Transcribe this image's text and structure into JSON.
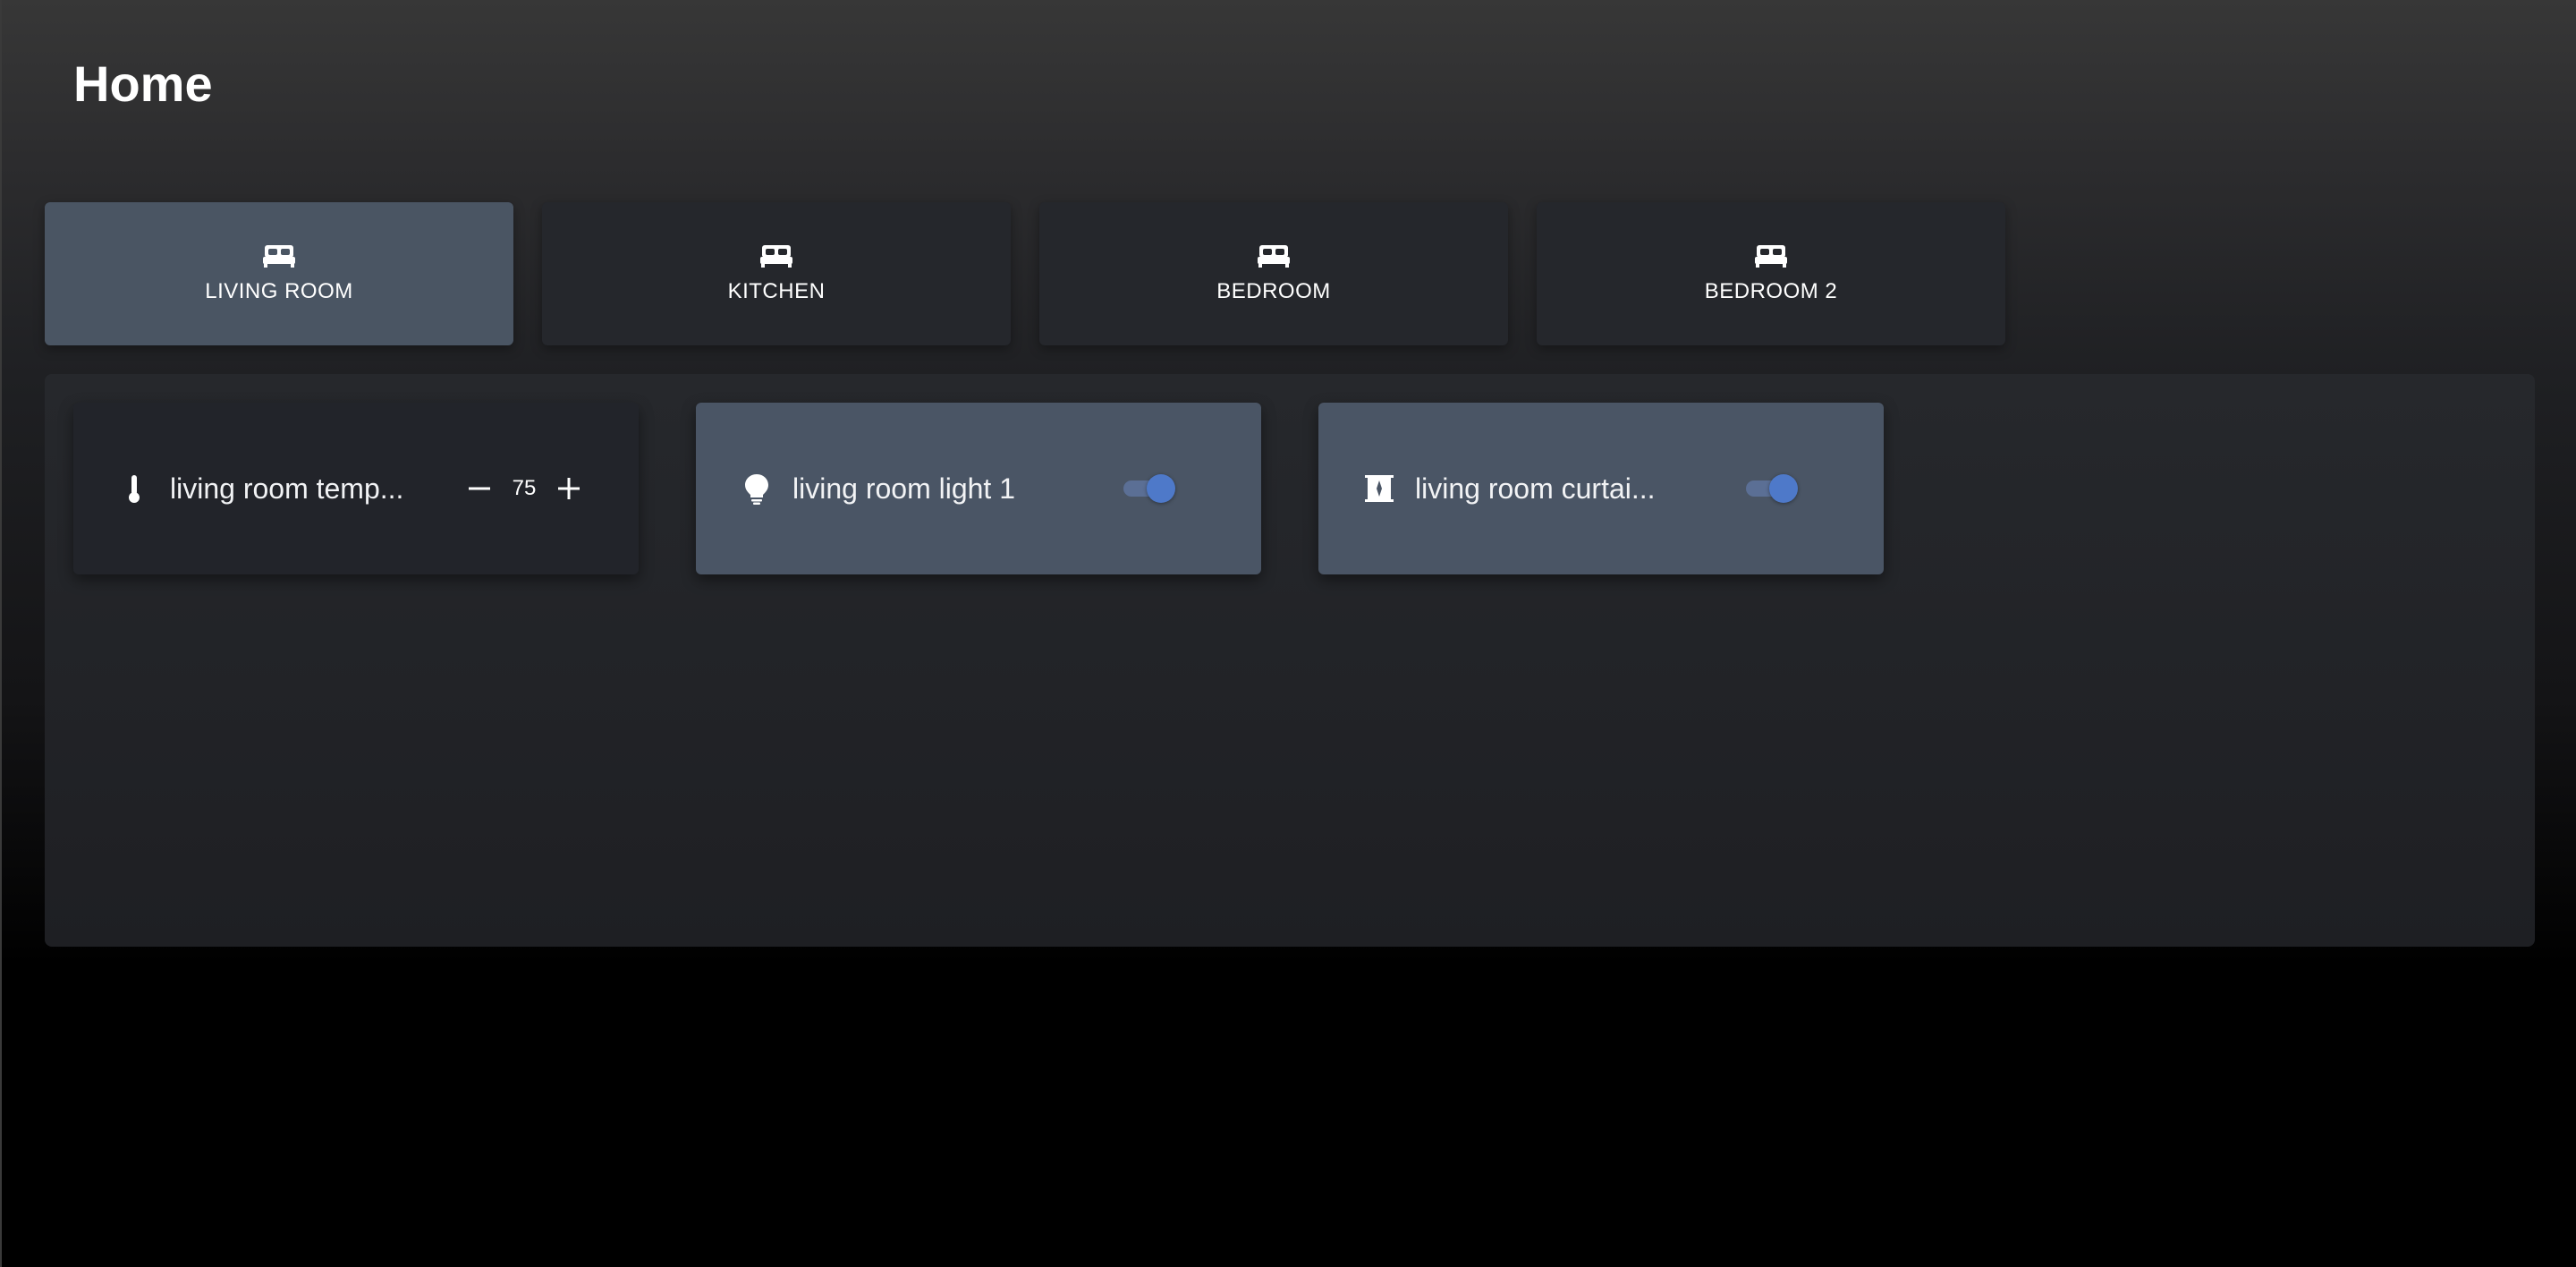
{
  "header": {
    "title": "Home"
  },
  "rooms": [
    {
      "label": "LIVING ROOM",
      "icon": "bed-icon",
      "active": true
    },
    {
      "label": "KITCHEN",
      "icon": "bed-icon",
      "active": false
    },
    {
      "label": "BEDROOM",
      "icon": "bed-icon",
      "active": false
    },
    {
      "label": "BEDROOM 2",
      "icon": "bed-icon",
      "active": false
    }
  ],
  "devices": {
    "thermostat": {
      "name": "living room temp...",
      "icon": "thermometer-icon",
      "value": "75",
      "decrement_icon": "minus-icon",
      "increment_icon": "plus-icon"
    },
    "light": {
      "name": "living room light 1",
      "icon": "lightbulb-icon",
      "state": "on"
    },
    "curtain": {
      "name": "living room curtai...",
      "icon": "curtain-icon",
      "state": "on"
    }
  },
  "colors": {
    "active_tab": "#4a5563",
    "inactive_tab": "#25272c",
    "device_on": "#4a5565",
    "device_off": "#22242a",
    "toggle_accent": "#4e79c9"
  }
}
